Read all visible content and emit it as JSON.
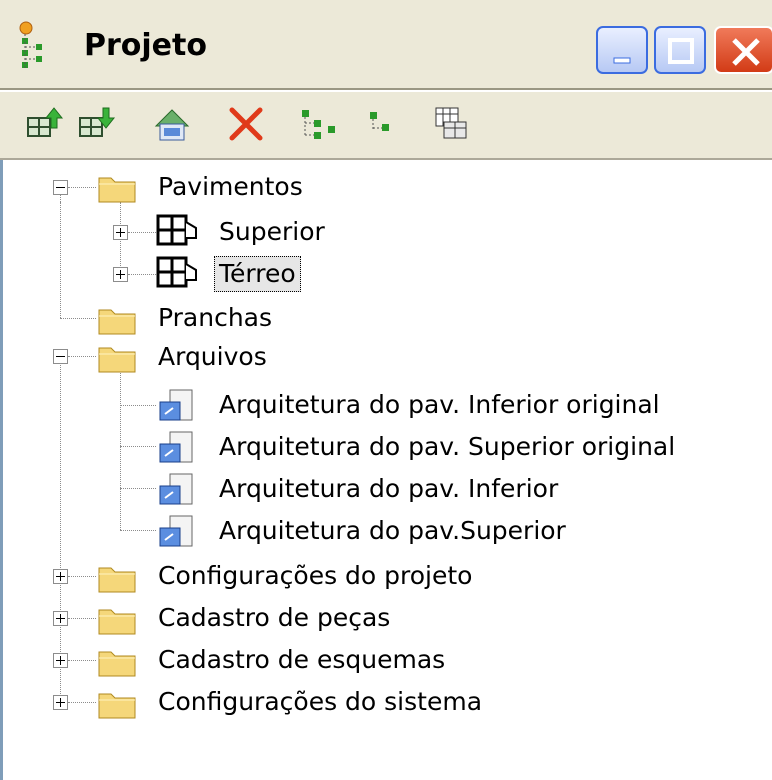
{
  "window": {
    "title": "Projeto"
  },
  "toolbar": {
    "buttons": [
      {
        "icon": "add-floor-above-icon"
      },
      {
        "icon": "add-floor-below-icon"
      },
      {
        "icon": "import-file-icon"
      },
      {
        "icon": "delete-icon"
      },
      {
        "icon": "expand-tree-icon"
      },
      {
        "icon": "collapse-tree-icon"
      },
      {
        "icon": "table-view-icon"
      }
    ]
  },
  "tree": {
    "pavimentos": {
      "label": "Pavimentos",
      "expanded": true,
      "children": [
        {
          "label": "Superior"
        },
        {
          "label": "Térreo",
          "selected": true
        }
      ]
    },
    "pranchas": {
      "label": "Pranchas"
    },
    "arquivos": {
      "label": "Arquivos",
      "expanded": true,
      "children": [
        {
          "label": "Arquitetura do pav. Inferior original"
        },
        {
          "label": "Arquitetura do pav. Superior original"
        },
        {
          "label": "Arquitetura do pav. Inferior"
        },
        {
          "label": "Arquitetura do pav.Superior"
        }
      ]
    },
    "config_projeto": {
      "label": "Configurações do projeto"
    },
    "cadastro_pecas": {
      "label": "Cadastro de peças"
    },
    "cadastro_esquemas": {
      "label": "Cadastro de esquemas"
    },
    "config_sistema": {
      "label": "Configurações do sistema"
    }
  },
  "colors": {
    "folder": "#f5d77a",
    "selected_bg": "#e6e6e6",
    "delete_red": "#e03a1a",
    "tree_green": "#2a9a2a"
  }
}
